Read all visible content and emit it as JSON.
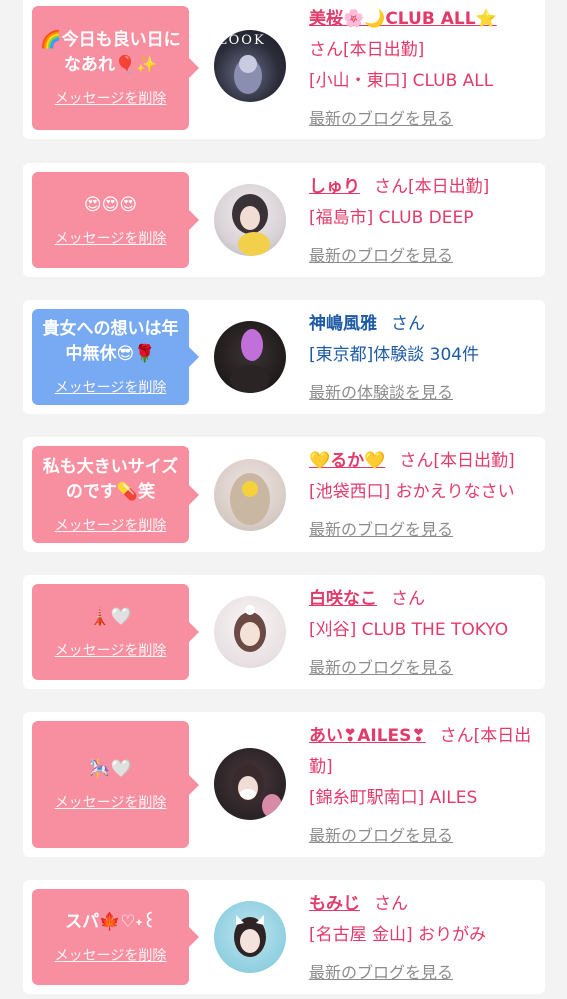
{
  "entries": [
    {
      "message": "🌈今日も良い日になあれ🎈✨",
      "delete_label": "メッセージを削除",
      "name": "美桜🌸🌙CLUB ALL⭐",
      "san": "さん",
      "shop": "[小山・東口] CLUB ALL",
      "status": "[本日出勤]",
      "blog_label": "最新のブログを見る",
      "avatar_caption": "LOOK"
    },
    {
      "message": "😍😍😍",
      "delete_label": "メッセージを削除",
      "name": "しゅり",
      "san": "さん",
      "status": "[本日出勤]",
      "shop": "[福島市] CLUB DEEP",
      "blog_label": "最新のブログを見る"
    },
    {
      "message": "貴女への想いは年中無休😎🌹",
      "delete_label": "メッセージを削除",
      "name": "神嶋風雅",
      "san": "さん",
      "shop": "[東京都]体験談 304件",
      "blog_label": "最新の体験談を見る"
    },
    {
      "message": "私も大きいサイズのです💊笑",
      "delete_label": "メッセージを削除",
      "name": "💛るか💛",
      "san": "さん",
      "status": "[本日出勤]",
      "shop": "[池袋西口] おかえりなさい",
      "blog_label": "最新のブログを見る"
    },
    {
      "message": "🗼🤍",
      "delete_label": "メッセージを削除",
      "name": "白咲なこ",
      "san": "さん",
      "shop": "[刈谷] CLUB THE TOKYO",
      "blog_label": "最新のブログを見る"
    },
    {
      "message": "🎠🤍",
      "delete_label": "メッセージを削除",
      "name": "あい❣AILES❣",
      "san": "さん",
      "status": "[本日出勤]",
      "shop": "[錦糸町駅南口] AILES",
      "blog_label": "最新のブログを見る"
    },
    {
      "message": "スパ🍁♡˖꒰",
      "delete_label": "メッセージを削除",
      "name": "もみじ",
      "san": "さん",
      "shop": "[名古屋 金山] おりがみ",
      "blog_label": "最新のブログを見る"
    }
  ],
  "colors": {
    "pink_bubble": "#f88fa0",
    "blue_bubble": "#77aaf2",
    "name_pink": "#e23b6a",
    "name_blue": "#1e5aa6",
    "link_gray": "#8c8c8c"
  }
}
